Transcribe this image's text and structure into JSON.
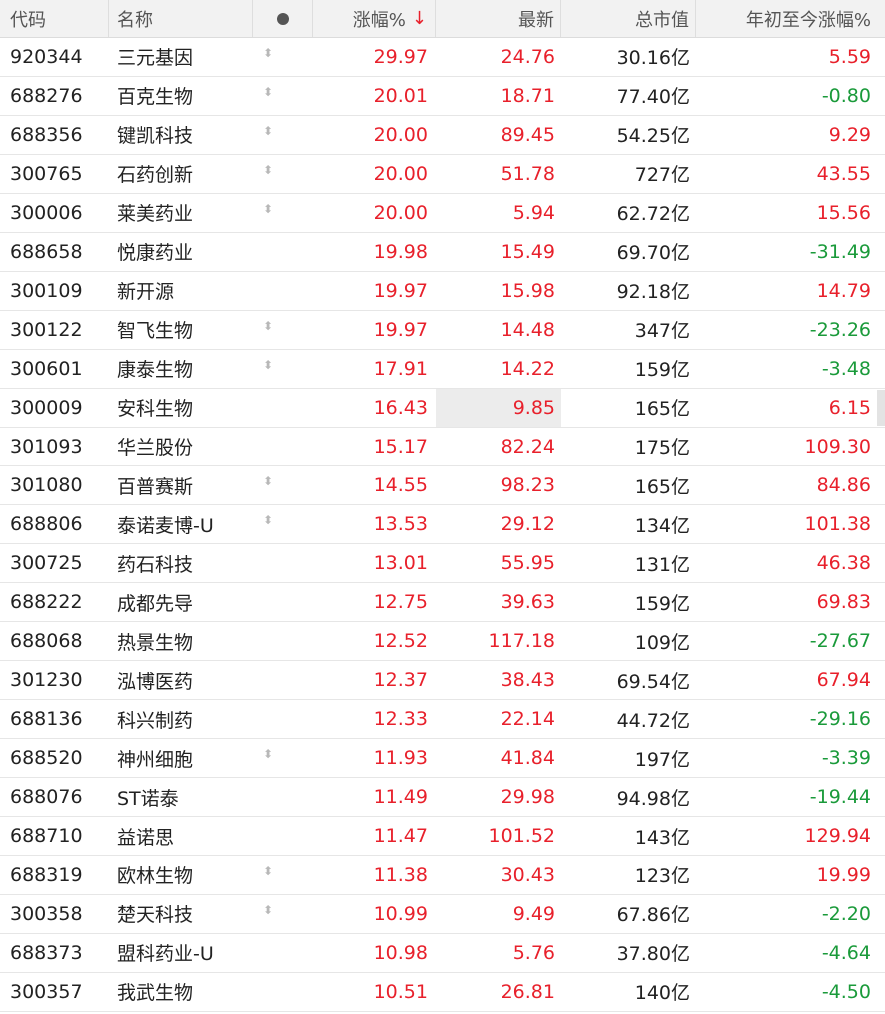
{
  "headers": {
    "code": "代码",
    "name": "名称",
    "change": "涨幅%",
    "sort_arrow": "↓",
    "last": "最新",
    "market_cap": "总市值",
    "ytd": "年初至今涨幅%"
  },
  "colors": {
    "up": "#e8202b",
    "down": "#1a9a3a"
  },
  "icons": {
    "header_flag": "dot-icon",
    "row_flag": "up-down-arrow-icon"
  },
  "rows": [
    {
      "code": "920344",
      "name": "三元基因",
      "flag": true,
      "change": "29.97",
      "last": "24.76",
      "cap": "30.16亿",
      "ytd": "5.59",
      "ytd_dir": "up"
    },
    {
      "code": "688276",
      "name": "百克生物",
      "flag": true,
      "change": "20.01",
      "last": "18.71",
      "cap": "77.40亿",
      "ytd": "-0.80",
      "ytd_dir": "down"
    },
    {
      "code": "688356",
      "name": "键凯科技",
      "flag": true,
      "change": "20.00",
      "last": "89.45",
      "cap": "54.25亿",
      "ytd": "9.29",
      "ytd_dir": "up"
    },
    {
      "code": "300765",
      "name": "石药创新",
      "flag": true,
      "change": "20.00",
      "last": "51.78",
      "cap": "727亿",
      "ytd": "43.55",
      "ytd_dir": "up"
    },
    {
      "code": "300006",
      "name": "莱美药业",
      "flag": true,
      "change": "20.00",
      "last": "5.94",
      "cap": "62.72亿",
      "ytd": "15.56",
      "ytd_dir": "up"
    },
    {
      "code": "688658",
      "name": "悦康药业",
      "flag": false,
      "change": "19.98",
      "last": "15.49",
      "cap": "69.70亿",
      "ytd": "-31.49",
      "ytd_dir": "down"
    },
    {
      "code": "300109",
      "name": "新开源",
      "flag": false,
      "change": "19.97",
      "last": "15.98",
      "cap": "92.18亿",
      "ytd": "14.79",
      "ytd_dir": "up"
    },
    {
      "code": "300122",
      "name": "智飞生物",
      "flag": true,
      "change": "19.97",
      "last": "14.48",
      "cap": "347亿",
      "ytd": "-23.26",
      "ytd_dir": "down"
    },
    {
      "code": "300601",
      "name": "康泰生物",
      "flag": true,
      "change": "17.91",
      "last": "14.22",
      "cap": "159亿",
      "ytd": "-3.48",
      "ytd_dir": "down"
    },
    {
      "code": "300009",
      "name": "安科生物",
      "flag": false,
      "change": "16.43",
      "last": "9.85",
      "cap": "165亿",
      "ytd": "6.15",
      "ytd_dir": "up",
      "highlight": true
    },
    {
      "code": "301093",
      "name": "华兰股份",
      "flag": false,
      "change": "15.17",
      "last": "82.24",
      "cap": "175亿",
      "ytd": "109.30",
      "ytd_dir": "up"
    },
    {
      "code": "301080",
      "name": "百普赛斯",
      "flag": true,
      "change": "14.55",
      "last": "98.23",
      "cap": "165亿",
      "ytd": "84.86",
      "ytd_dir": "up"
    },
    {
      "code": "688806",
      "name": "泰诺麦博-U",
      "flag": true,
      "change": "13.53",
      "last": "29.12",
      "cap": "134亿",
      "ytd": "101.38",
      "ytd_dir": "up"
    },
    {
      "code": "300725",
      "name": "药石科技",
      "flag": false,
      "change": "13.01",
      "last": "55.95",
      "cap": "131亿",
      "ytd": "46.38",
      "ytd_dir": "up"
    },
    {
      "code": "688222",
      "name": "成都先导",
      "flag": false,
      "change": "12.75",
      "last": "39.63",
      "cap": "159亿",
      "ytd": "69.83",
      "ytd_dir": "up"
    },
    {
      "code": "688068",
      "name": "热景生物",
      "flag": false,
      "change": "12.52",
      "last": "117.18",
      "cap": "109亿",
      "ytd": "-27.67",
      "ytd_dir": "down"
    },
    {
      "code": "301230",
      "name": "泓博医药",
      "flag": false,
      "change": "12.37",
      "last": "38.43",
      "cap": "69.54亿",
      "ytd": "67.94",
      "ytd_dir": "up"
    },
    {
      "code": "688136",
      "name": "科兴制药",
      "flag": false,
      "change": "12.33",
      "last": "22.14",
      "cap": "44.72亿",
      "ytd": "-29.16",
      "ytd_dir": "down"
    },
    {
      "code": "688520",
      "name": "神州细胞",
      "flag": true,
      "change": "11.93",
      "last": "41.84",
      "cap": "197亿",
      "ytd": "-3.39",
      "ytd_dir": "down"
    },
    {
      "code": "688076",
      "name": "ST诺泰",
      "flag": false,
      "change": "11.49",
      "last": "29.98",
      "cap": "94.98亿",
      "ytd": "-19.44",
      "ytd_dir": "down"
    },
    {
      "code": "688710",
      "name": "益诺思",
      "flag": false,
      "change": "11.47",
      "last": "101.52",
      "cap": "143亿",
      "ytd": "129.94",
      "ytd_dir": "up"
    },
    {
      "code": "688319",
      "name": "欧林生物",
      "flag": true,
      "change": "11.38",
      "last": "30.43",
      "cap": "123亿",
      "ytd": "19.99",
      "ytd_dir": "up"
    },
    {
      "code": "300358",
      "name": "楚天科技",
      "flag": true,
      "change": "10.99",
      "last": "9.49",
      "cap": "67.86亿",
      "ytd": "-2.20",
      "ytd_dir": "down"
    },
    {
      "code": "688373",
      "name": "盟科药业-U",
      "flag": false,
      "change": "10.98",
      "last": "5.76",
      "cap": "37.80亿",
      "ytd": "-4.64",
      "ytd_dir": "down"
    },
    {
      "code": "300357",
      "name": "我武生物",
      "flag": false,
      "change": "10.51",
      "last": "26.81",
      "cap": "140亿",
      "ytd": "-4.50",
      "ytd_dir": "down"
    }
  ]
}
